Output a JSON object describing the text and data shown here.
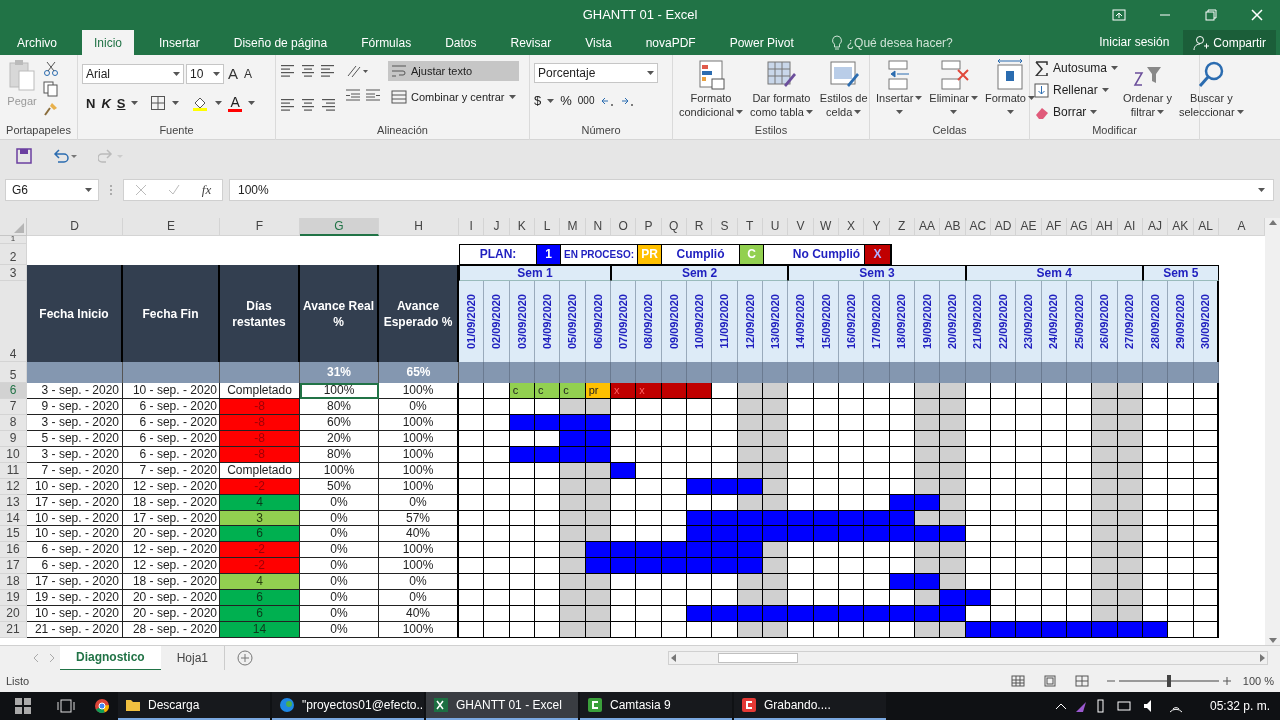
{
  "window": {
    "title": "GHANTT 01 - Excel"
  },
  "menu_tabs": [
    {
      "label": "Archivo",
      "selected": false
    },
    {
      "label": "Inicio",
      "selected": true
    },
    {
      "label": "Insertar",
      "selected": false
    },
    {
      "label": "Diseño de página",
      "selected": false
    },
    {
      "label": "Fórmulas",
      "selected": false
    },
    {
      "label": "Datos",
      "selected": false
    },
    {
      "label": "Revisar",
      "selected": false
    },
    {
      "label": "Vista",
      "selected": false
    },
    {
      "label": "novaPDF",
      "selected": false
    },
    {
      "label": "Power Pivot",
      "selected": false
    }
  ],
  "tell_me": {
    "placeholder": "¿Qué desea hacer?"
  },
  "account": {
    "sign_in": "Iniciar sesión",
    "share": "Compartir"
  },
  "ribbon": {
    "clipboard": {
      "label": "Portapapeles",
      "paste": "Pegar"
    },
    "font": {
      "label": "Fuente",
      "name": "Arial",
      "size": "10",
      "grow": "A",
      "shrink": "A",
      "bold": "N",
      "italic": "K",
      "underline": "S",
      "color_letter": "A"
    },
    "alignment": {
      "label": "Alineación",
      "wrap": "Ajustar texto",
      "wrap_on": true,
      "merge": "Combinar y centrar"
    },
    "number": {
      "label": "Número",
      "format": "Porcentaje",
      "currency": "$",
      "percent": "%",
      "thousands": "000"
    },
    "styles": {
      "label": "Estilos",
      "buttons": [
        {
          "lines": [
            "Formato",
            "condicional"
          ]
        },
        {
          "lines": [
            "Dar formato",
            "como tabla"
          ]
        },
        {
          "lines": [
            "Estilos de",
            "celda"
          ]
        }
      ]
    },
    "cells": {
      "label": "Celdas",
      "buttons": [
        {
          "lines": [
            "Insertar"
          ]
        },
        {
          "lines": [
            "Eliminar"
          ]
        },
        {
          "lines": [
            "Formato"
          ]
        }
      ]
    },
    "editing": {
      "label": "Modificar",
      "small": [
        "Autosuma",
        "Rellenar",
        "Borrar"
      ],
      "buttons": [
        {
          "lines": [
            "Ordenar y",
            "filtrar"
          ]
        },
        {
          "lines": [
            "Buscar y",
            "seleccionar"
          ]
        }
      ]
    }
  },
  "formula_bar": {
    "name_box": "G6",
    "fx": "fx",
    "value": "100%"
  },
  "sheet": {
    "columns": [
      {
        "label": "D",
        "selected": false
      },
      {
        "label": "E",
        "selected": false
      },
      {
        "label": "F",
        "selected": false
      },
      {
        "label": "G",
        "selected": true
      },
      {
        "label": "H",
        "selected": false
      },
      {
        "label": "I",
        "selected": false
      },
      {
        "label": "J",
        "selected": false
      },
      {
        "label": "K",
        "selected": false
      },
      {
        "label": "L",
        "selected": false
      },
      {
        "label": "M",
        "selected": false
      },
      {
        "label": "N",
        "selected": false
      },
      {
        "label": "O",
        "selected": false
      },
      {
        "label": "P",
        "selected": false
      },
      {
        "label": "Q",
        "selected": false
      },
      {
        "label": "R",
        "selected": false
      },
      {
        "label": "S",
        "selected": false
      },
      {
        "label": "T",
        "selected": false
      },
      {
        "label": "U",
        "selected": false
      },
      {
        "label": "V",
        "selected": false
      },
      {
        "label": "W",
        "selected": false
      },
      {
        "label": "X",
        "selected": false
      },
      {
        "label": "Y",
        "selected": false
      },
      {
        "label": "Z",
        "selected": false
      },
      {
        "label": "AA",
        "selected": false
      },
      {
        "label": "AB",
        "selected": false
      },
      {
        "label": "AC",
        "selected": false
      },
      {
        "label": "AD",
        "selected": false
      },
      {
        "label": "AE",
        "selected": false
      },
      {
        "label": "AF",
        "selected": false
      },
      {
        "label": "AG",
        "selected": false
      },
      {
        "label": "AH",
        "selected": false
      },
      {
        "label": "AI",
        "selected": false
      },
      {
        "label": "AJ",
        "selected": false
      },
      {
        "label": "AK",
        "selected": false
      },
      {
        "label": "AL",
        "selected": false
      },
      {
        "label": "A",
        "selected": false
      }
    ],
    "header_rows": [
      "1",
      "2",
      "3",
      "4",
      "5"
    ],
    "legend": [
      {
        "text": "PLAN:",
        "kind": "label"
      },
      {
        "text": "1",
        "kind": "swatch",
        "color": "#0000ff"
      },
      {
        "text": "EN PROCESO:",
        "kind": "label"
      },
      {
        "text": "PR",
        "kind": "swatch",
        "color": "#ffc000"
      },
      {
        "text": "Cumplió",
        "kind": "label"
      },
      {
        "text": "C",
        "kind": "swatch",
        "color": "#92d050"
      },
      {
        "kind": "blank"
      },
      {
        "text": "No Cumplió",
        "kind": "label"
      },
      {
        "text": "X",
        "kind": "swatch",
        "color": "#c00000"
      }
    ],
    "headers": [
      "Fecha Inicio",
      "Fecha Fin",
      "Días restantes",
      "Avance Real %",
      "Avance Esperado %"
    ],
    "totals": {
      "real": "31%",
      "expected": "65%"
    },
    "weeks": [
      {
        "label": "Sem 1",
        "days": [
          {
            "date": "01/09/2020",
            "weekend": false
          },
          {
            "date": "02/09/2020",
            "weekend": false
          },
          {
            "date": "03/09/2020",
            "weekend": false
          },
          {
            "date": "04/09/2020",
            "weekend": false
          },
          {
            "date": "05/09/2020",
            "weekend": true
          },
          {
            "date": "06/09/2020",
            "weekend": true
          }
        ]
      },
      {
        "label": "Sem 2",
        "days": [
          {
            "date": "07/09/2020",
            "weekend": false
          },
          {
            "date": "08/09/2020",
            "weekend": false
          },
          {
            "date": "09/09/2020",
            "weekend": false
          },
          {
            "date": "10/09/2020",
            "weekend": false
          },
          {
            "date": "11/09/2020",
            "weekend": false
          },
          {
            "date": "12/09/2020",
            "weekend": true
          },
          {
            "date": "13/09/2020",
            "weekend": true
          }
        ]
      },
      {
        "label": "Sem 3",
        "days": [
          {
            "date": "14/09/2020",
            "weekend": false
          },
          {
            "date": "15/09/2020",
            "weekend": false
          },
          {
            "date": "16/09/2020",
            "weekend": false
          },
          {
            "date": "17/09/2020",
            "weekend": false
          },
          {
            "date": "18/09/2020",
            "weekend": false
          },
          {
            "date": "19/09/2020",
            "weekend": true
          },
          {
            "date": "20/09/2020",
            "weekend": true
          }
        ]
      },
      {
        "label": "Sem 4",
        "days": [
          {
            "date": "21/09/2020",
            "weekend": false
          },
          {
            "date": "22/09/2020",
            "weekend": false
          },
          {
            "date": "23/09/2020",
            "weekend": false
          },
          {
            "date": "24/09/2020",
            "weekend": false
          },
          {
            "date": "25/09/2020",
            "weekend": false
          },
          {
            "date": "26/09/2020",
            "weekend": true
          },
          {
            "date": "27/09/2020",
            "weekend": true
          }
        ]
      },
      {
        "label": "Sem 5",
        "days": [
          {
            "date": "28/09/2020",
            "weekend": false
          },
          {
            "date": "29/09/2020",
            "weekend": false
          },
          {
            "date": "30/09/2020",
            "weekend": false
          }
        ]
      }
    ],
    "rows": [
      {
        "num": "6",
        "start": "3 - sep. - 2020",
        "end": "10 - sep. - 2020",
        "remaining": "Completado",
        "real": "100%",
        "expected": "100%",
        "selected": true,
        "gantt": [
          {
            "kind": "empty"
          },
          {
            "kind": "empty"
          },
          {
            "kind": "done",
            "label": "c"
          },
          {
            "kind": "done",
            "label": "c"
          },
          {
            "kind": "done",
            "label": "c"
          },
          {
            "kind": "progress",
            "label": "pr"
          },
          {
            "kind": "fail",
            "label": "x"
          },
          {
            "kind": "fail",
            "label": "x"
          },
          {
            "kind": "fail"
          },
          {
            "kind": "fail"
          },
          {
            "kind": "empty"
          },
          {
            "kind": "empty"
          },
          {
            "kind": "empty"
          },
          {
            "kind": "empty"
          },
          {
            "kind": "empty"
          },
          {
            "kind": "empty"
          },
          {
            "kind": "empty"
          },
          {
            "kind": "empty"
          },
          {
            "kind": "empty"
          },
          {
            "kind": "empty"
          },
          {
            "kind": "empty"
          },
          {
            "kind": "empty"
          },
          {
            "kind": "empty"
          },
          {
            "kind": "empty"
          },
          {
            "kind": "empty"
          },
          {
            "kind": "empty"
          },
          {
            "kind": "empty"
          },
          {
            "kind": "empty"
          },
          {
            "kind": "empty"
          },
          {
            "kind": "empty"
          }
        ]
      },
      {
        "num": "7",
        "start": "9 - sep. - 2020",
        "end": "6 - sep. - 2020",
        "remaining": "-8",
        "color": "#ff0000",
        "real": "80%",
        "expected": "0%",
        "selected": false,
        "gantt": [
          {
            "kind": "empty"
          },
          {
            "kind": "empty"
          },
          {
            "kind": "empty"
          },
          {
            "kind": "empty"
          },
          {
            "kind": "empty"
          },
          {
            "kind": "empty"
          },
          {
            "kind": "empty"
          },
          {
            "kind": "empty"
          },
          {
            "kind": "empty"
          },
          {
            "kind": "empty"
          },
          {
            "kind": "empty"
          },
          {
            "kind": "empty"
          },
          {
            "kind": "empty"
          },
          {
            "kind": "empty"
          },
          {
            "kind": "empty"
          },
          {
            "kind": "empty"
          },
          {
            "kind": "empty"
          },
          {
            "kind": "empty"
          },
          {
            "kind": "empty"
          },
          {
            "kind": "empty"
          },
          {
            "kind": "empty"
          },
          {
            "kind": "empty"
          },
          {
            "kind": "empty"
          },
          {
            "kind": "empty"
          },
          {
            "kind": "empty"
          },
          {
            "kind": "empty"
          },
          {
            "kind": "empty"
          },
          {
            "kind": "empty"
          },
          {
            "kind": "empty"
          },
          {
            "kind": "empty"
          }
        ]
      },
      {
        "num": "8",
        "start": "3 - sep. - 2020",
        "end": "6 - sep. - 2020",
        "remaining": "-8",
        "color": "#ff0000",
        "real": "60%",
        "expected": "100%",
        "selected": false,
        "gantt": [
          {
            "kind": "empty"
          },
          {
            "kind": "empty"
          },
          {
            "kind": "plan"
          },
          {
            "kind": "plan"
          },
          {
            "kind": "plan"
          },
          {
            "kind": "plan"
          },
          {
            "kind": "empty"
          },
          {
            "kind": "empty"
          },
          {
            "kind": "empty"
          },
          {
            "kind": "empty"
          },
          {
            "kind": "empty"
          },
          {
            "kind": "empty"
          },
          {
            "kind": "empty"
          },
          {
            "kind": "empty"
          },
          {
            "kind": "empty"
          },
          {
            "kind": "empty"
          },
          {
            "kind": "empty"
          },
          {
            "kind": "empty"
          },
          {
            "kind": "empty"
          },
          {
            "kind": "empty"
          },
          {
            "kind": "empty"
          },
          {
            "kind": "empty"
          },
          {
            "kind": "empty"
          },
          {
            "kind": "empty"
          },
          {
            "kind": "empty"
          },
          {
            "kind": "empty"
          },
          {
            "kind": "empty"
          },
          {
            "kind": "empty"
          },
          {
            "kind": "empty"
          },
          {
            "kind": "empty"
          }
        ]
      },
      {
        "num": "9",
        "start": "5 - sep. - 2020",
        "end": "6 - sep. - 2020",
        "remaining": "-8",
        "color": "#ff0000",
        "real": "20%",
        "expected": "100%",
        "selected": false,
        "gantt": [
          {
            "kind": "empty"
          },
          {
            "kind": "empty"
          },
          {
            "kind": "empty"
          },
          {
            "kind": "empty"
          },
          {
            "kind": "plan"
          },
          {
            "kind": "plan"
          },
          {
            "kind": "empty"
          },
          {
            "kind": "empty"
          },
          {
            "kind": "empty"
          },
          {
            "kind": "empty"
          },
          {
            "kind": "empty"
          },
          {
            "kind": "empty"
          },
          {
            "kind": "empty"
          },
          {
            "kind": "empty"
          },
          {
            "kind": "empty"
          },
          {
            "kind": "empty"
          },
          {
            "kind": "empty"
          },
          {
            "kind": "empty"
          },
          {
            "kind": "empty"
          },
          {
            "kind": "empty"
          },
          {
            "kind": "empty"
          },
          {
            "kind": "empty"
          },
          {
            "kind": "empty"
          },
          {
            "kind": "empty"
          },
          {
            "kind": "empty"
          },
          {
            "kind": "empty"
          },
          {
            "kind": "empty"
          },
          {
            "kind": "empty"
          },
          {
            "kind": "empty"
          },
          {
            "kind": "empty"
          }
        ]
      },
      {
        "num": "10",
        "start": "3 - sep. - 2020",
        "end": "6 - sep. - 2020",
        "remaining": "-8",
        "color": "#ff0000",
        "real": "80%",
        "expected": "100%",
        "selected": false,
        "gantt": [
          {
            "kind": "empty"
          },
          {
            "kind": "empty"
          },
          {
            "kind": "plan"
          },
          {
            "kind": "plan"
          },
          {
            "kind": "plan"
          },
          {
            "kind": "plan"
          },
          {
            "kind": "empty"
          },
          {
            "kind": "empty"
          },
          {
            "kind": "empty"
          },
          {
            "kind": "empty"
          },
          {
            "kind": "empty"
          },
          {
            "kind": "empty"
          },
          {
            "kind": "empty"
          },
          {
            "kind": "empty"
          },
          {
            "kind": "empty"
          },
          {
            "kind": "empty"
          },
          {
            "kind": "empty"
          },
          {
            "kind": "empty"
          },
          {
            "kind": "empty"
          },
          {
            "kind": "empty"
          },
          {
            "kind": "empty"
          },
          {
            "kind": "empty"
          },
          {
            "kind": "empty"
          },
          {
            "kind": "empty"
          },
          {
            "kind": "empty"
          },
          {
            "kind": "empty"
          },
          {
            "kind": "empty"
          },
          {
            "kind": "empty"
          },
          {
            "kind": "empty"
          },
          {
            "kind": "empty"
          }
        ]
      },
      {
        "num": "11",
        "start": "7 - sep. - 2020",
        "end": "7 - sep. - 2020",
        "remaining": "Completado",
        "real": "100%",
        "expected": "100%",
        "selected": false,
        "gantt": [
          {
            "kind": "empty"
          },
          {
            "kind": "empty"
          },
          {
            "kind": "empty"
          },
          {
            "kind": "empty"
          },
          {
            "kind": "empty"
          },
          {
            "kind": "empty"
          },
          {
            "kind": "plan"
          },
          {
            "kind": "empty"
          },
          {
            "kind": "empty"
          },
          {
            "kind": "empty"
          },
          {
            "kind": "empty"
          },
          {
            "kind": "empty"
          },
          {
            "kind": "empty"
          },
          {
            "kind": "empty"
          },
          {
            "kind": "empty"
          },
          {
            "kind": "empty"
          },
          {
            "kind": "empty"
          },
          {
            "kind": "empty"
          },
          {
            "kind": "empty"
          },
          {
            "kind": "empty"
          },
          {
            "kind": "empty"
          },
          {
            "kind": "empty"
          },
          {
            "kind": "empty"
          },
          {
            "kind": "empty"
          },
          {
            "kind": "empty"
          },
          {
            "kind": "empty"
          },
          {
            "kind": "empty"
          },
          {
            "kind": "empty"
          },
          {
            "kind": "empty"
          },
          {
            "kind": "empty"
          }
        ]
      },
      {
        "num": "12",
        "start": "10 - sep. - 2020",
        "end": "12 - sep. - 2020",
        "remaining": "-2",
        "color": "#ff0000",
        "real": "50%",
        "expected": "100%",
        "selected": false,
        "gantt": [
          {
            "kind": "empty"
          },
          {
            "kind": "empty"
          },
          {
            "kind": "empty"
          },
          {
            "kind": "empty"
          },
          {
            "kind": "empty"
          },
          {
            "kind": "empty"
          },
          {
            "kind": "empty"
          },
          {
            "kind": "empty"
          },
          {
            "kind": "empty"
          },
          {
            "kind": "plan"
          },
          {
            "kind": "plan"
          },
          {
            "kind": "plan"
          },
          {
            "kind": "empty"
          },
          {
            "kind": "empty"
          },
          {
            "kind": "empty"
          },
          {
            "kind": "empty"
          },
          {
            "kind": "empty"
          },
          {
            "kind": "empty"
          },
          {
            "kind": "empty"
          },
          {
            "kind": "empty"
          },
          {
            "kind": "empty"
          },
          {
            "kind": "empty"
          },
          {
            "kind": "empty"
          },
          {
            "kind": "empty"
          },
          {
            "kind": "empty"
          },
          {
            "kind": "empty"
          },
          {
            "kind": "empty"
          },
          {
            "kind": "empty"
          },
          {
            "kind": "empty"
          },
          {
            "kind": "empty"
          }
        ]
      },
      {
        "num": "13",
        "start": "17 - sep. - 2020",
        "end": "18 - sep. - 2020",
        "remaining": "4",
        "color": "#00b050",
        "real": "0%",
        "expected": "0%",
        "selected": false,
        "gantt": [
          {
            "kind": "empty"
          },
          {
            "kind": "empty"
          },
          {
            "kind": "empty"
          },
          {
            "kind": "empty"
          },
          {
            "kind": "empty"
          },
          {
            "kind": "empty"
          },
          {
            "kind": "empty"
          },
          {
            "kind": "empty"
          },
          {
            "kind": "empty"
          },
          {
            "kind": "empty"
          },
          {
            "kind": "empty"
          },
          {
            "kind": "empty"
          },
          {
            "kind": "empty"
          },
          {
            "kind": "empty"
          },
          {
            "kind": "empty"
          },
          {
            "kind": "empty"
          },
          {
            "kind": "empty"
          },
          {
            "kind": "plan"
          },
          {
            "kind": "plan"
          },
          {
            "kind": "empty"
          },
          {
            "kind": "empty"
          },
          {
            "kind": "empty"
          },
          {
            "kind": "empty"
          },
          {
            "kind": "empty"
          },
          {
            "kind": "empty"
          },
          {
            "kind": "empty"
          },
          {
            "kind": "empty"
          },
          {
            "kind": "empty"
          },
          {
            "kind": "empty"
          },
          {
            "kind": "empty"
          }
        ]
      },
      {
        "num": "14",
        "start": "10 - sep. - 2020",
        "end": "17 - sep. - 2020",
        "remaining": "3",
        "color": "#92d050",
        "real": "0%",
        "expected": "57%",
        "selected": false,
        "gantt": [
          {
            "kind": "empty"
          },
          {
            "kind": "empty"
          },
          {
            "kind": "empty"
          },
          {
            "kind": "empty"
          },
          {
            "kind": "empty"
          },
          {
            "kind": "empty"
          },
          {
            "kind": "empty"
          },
          {
            "kind": "empty"
          },
          {
            "kind": "empty"
          },
          {
            "kind": "plan"
          },
          {
            "kind": "plan"
          },
          {
            "kind": "plan"
          },
          {
            "kind": "plan"
          },
          {
            "kind": "plan"
          },
          {
            "kind": "plan"
          },
          {
            "kind": "plan"
          },
          {
            "kind": "plan"
          },
          {
            "kind": "plan"
          },
          {
            "kind": "empty"
          },
          {
            "kind": "empty"
          },
          {
            "kind": "empty"
          },
          {
            "kind": "empty"
          },
          {
            "kind": "empty"
          },
          {
            "kind": "empty"
          },
          {
            "kind": "empty"
          },
          {
            "kind": "empty"
          },
          {
            "kind": "empty"
          },
          {
            "kind": "empty"
          },
          {
            "kind": "empty"
          },
          {
            "kind": "empty"
          }
        ]
      },
      {
        "num": "15",
        "start": "10 - sep. - 2020",
        "end": "20 - sep. - 2020",
        "remaining": "6",
        "color": "#00b050",
        "real": "0%",
        "expected": "40%",
        "selected": false,
        "gantt": [
          {
            "kind": "empty"
          },
          {
            "kind": "empty"
          },
          {
            "kind": "empty"
          },
          {
            "kind": "empty"
          },
          {
            "kind": "empty"
          },
          {
            "kind": "empty"
          },
          {
            "kind": "empty"
          },
          {
            "kind": "empty"
          },
          {
            "kind": "empty"
          },
          {
            "kind": "plan"
          },
          {
            "kind": "plan"
          },
          {
            "kind": "plan"
          },
          {
            "kind": "plan"
          },
          {
            "kind": "plan"
          },
          {
            "kind": "plan"
          },
          {
            "kind": "plan"
          },
          {
            "kind": "plan"
          },
          {
            "kind": "plan"
          },
          {
            "kind": "plan"
          },
          {
            "kind": "plan"
          },
          {
            "kind": "empty"
          },
          {
            "kind": "empty"
          },
          {
            "kind": "empty"
          },
          {
            "kind": "empty"
          },
          {
            "kind": "empty"
          },
          {
            "kind": "empty"
          },
          {
            "kind": "empty"
          },
          {
            "kind": "empty"
          },
          {
            "kind": "empty"
          },
          {
            "kind": "empty"
          }
        ]
      },
      {
        "num": "16",
        "start": "6 - sep. - 2020",
        "end": "12 - sep. - 2020",
        "remaining": "-2",
        "color": "#ff0000",
        "real": "0%",
        "expected": "100%",
        "selected": false,
        "gantt": [
          {
            "kind": "empty"
          },
          {
            "kind": "empty"
          },
          {
            "kind": "empty"
          },
          {
            "kind": "empty"
          },
          {
            "kind": "empty"
          },
          {
            "kind": "plan"
          },
          {
            "kind": "plan"
          },
          {
            "kind": "plan"
          },
          {
            "kind": "plan"
          },
          {
            "kind": "plan"
          },
          {
            "kind": "plan"
          },
          {
            "kind": "plan"
          },
          {
            "kind": "empty"
          },
          {
            "kind": "empty"
          },
          {
            "kind": "empty"
          },
          {
            "kind": "empty"
          },
          {
            "kind": "empty"
          },
          {
            "kind": "empty"
          },
          {
            "kind": "empty"
          },
          {
            "kind": "empty"
          },
          {
            "kind": "empty"
          },
          {
            "kind": "empty"
          },
          {
            "kind": "empty"
          },
          {
            "kind": "empty"
          },
          {
            "kind": "empty"
          },
          {
            "kind": "empty"
          },
          {
            "kind": "empty"
          },
          {
            "kind": "empty"
          },
          {
            "kind": "empty"
          },
          {
            "kind": "empty"
          }
        ]
      },
      {
        "num": "17",
        "start": "6 - sep. - 2020",
        "end": "12 - sep. - 2020",
        "remaining": "-2",
        "color": "#ff0000",
        "real": "0%",
        "expected": "100%",
        "selected": false,
        "gantt": [
          {
            "kind": "empty"
          },
          {
            "kind": "empty"
          },
          {
            "kind": "empty"
          },
          {
            "kind": "empty"
          },
          {
            "kind": "empty"
          },
          {
            "kind": "plan"
          },
          {
            "kind": "plan"
          },
          {
            "kind": "plan"
          },
          {
            "kind": "plan"
          },
          {
            "kind": "plan"
          },
          {
            "kind": "plan"
          },
          {
            "kind": "plan"
          },
          {
            "kind": "empty"
          },
          {
            "kind": "empty"
          },
          {
            "kind": "empty"
          },
          {
            "kind": "empty"
          },
          {
            "kind": "empty"
          },
          {
            "kind": "empty"
          },
          {
            "kind": "empty"
          },
          {
            "kind": "empty"
          },
          {
            "kind": "empty"
          },
          {
            "kind": "empty"
          },
          {
            "kind": "empty"
          },
          {
            "kind": "empty"
          },
          {
            "kind": "empty"
          },
          {
            "kind": "empty"
          },
          {
            "kind": "empty"
          },
          {
            "kind": "empty"
          },
          {
            "kind": "empty"
          },
          {
            "kind": "empty"
          }
        ]
      },
      {
        "num": "18",
        "start": "17 - sep. - 2020",
        "end": "18 - sep. - 2020",
        "remaining": "4",
        "color": "#92d050",
        "real": "0%",
        "expected": "0%",
        "selected": false,
        "gantt": [
          {
            "kind": "empty"
          },
          {
            "kind": "empty"
          },
          {
            "kind": "empty"
          },
          {
            "kind": "empty"
          },
          {
            "kind": "empty"
          },
          {
            "kind": "empty"
          },
          {
            "kind": "empty"
          },
          {
            "kind": "empty"
          },
          {
            "kind": "empty"
          },
          {
            "kind": "empty"
          },
          {
            "kind": "empty"
          },
          {
            "kind": "empty"
          },
          {
            "kind": "empty"
          },
          {
            "kind": "empty"
          },
          {
            "kind": "empty"
          },
          {
            "kind": "empty"
          },
          {
            "kind": "empty"
          },
          {
            "kind": "plan"
          },
          {
            "kind": "plan"
          },
          {
            "kind": "empty"
          },
          {
            "kind": "empty"
          },
          {
            "kind": "empty"
          },
          {
            "kind": "empty"
          },
          {
            "kind": "empty"
          },
          {
            "kind": "empty"
          },
          {
            "kind": "empty"
          },
          {
            "kind": "empty"
          },
          {
            "kind": "empty"
          },
          {
            "kind": "empty"
          },
          {
            "kind": "empty"
          }
        ]
      },
      {
        "num": "19",
        "start": "19 - sep. - 2020",
        "end": "20 - sep. - 2020",
        "remaining": "6",
        "color": "#00b050",
        "real": "0%",
        "expected": "0%",
        "selected": false,
        "gantt": [
          {
            "kind": "empty"
          },
          {
            "kind": "empty"
          },
          {
            "kind": "empty"
          },
          {
            "kind": "empty"
          },
          {
            "kind": "empty"
          },
          {
            "kind": "empty"
          },
          {
            "kind": "empty"
          },
          {
            "kind": "empty"
          },
          {
            "kind": "empty"
          },
          {
            "kind": "empty"
          },
          {
            "kind": "empty"
          },
          {
            "kind": "empty"
          },
          {
            "kind": "empty"
          },
          {
            "kind": "empty"
          },
          {
            "kind": "empty"
          },
          {
            "kind": "empty"
          },
          {
            "kind": "empty"
          },
          {
            "kind": "empty"
          },
          {
            "kind": "empty"
          },
          {
            "kind": "plan"
          },
          {
            "kind": "plan"
          },
          {
            "kind": "empty"
          },
          {
            "kind": "empty"
          },
          {
            "kind": "empty"
          },
          {
            "kind": "empty"
          },
          {
            "kind": "empty"
          },
          {
            "kind": "empty"
          },
          {
            "kind": "empty"
          },
          {
            "kind": "empty"
          },
          {
            "kind": "empty"
          }
        ]
      },
      {
        "num": "20",
        "start": "10 - sep. - 2020",
        "end": "20 - sep. - 2020",
        "remaining": "6",
        "color": "#00b050",
        "real": "0%",
        "expected": "40%",
        "selected": false,
        "gantt": [
          {
            "kind": "empty"
          },
          {
            "kind": "empty"
          },
          {
            "kind": "empty"
          },
          {
            "kind": "empty"
          },
          {
            "kind": "empty"
          },
          {
            "kind": "empty"
          },
          {
            "kind": "empty"
          },
          {
            "kind": "empty"
          },
          {
            "kind": "empty"
          },
          {
            "kind": "plan"
          },
          {
            "kind": "plan"
          },
          {
            "kind": "plan"
          },
          {
            "kind": "plan"
          },
          {
            "kind": "plan"
          },
          {
            "kind": "plan"
          },
          {
            "kind": "plan"
          },
          {
            "kind": "plan"
          },
          {
            "kind": "plan"
          },
          {
            "kind": "plan"
          },
          {
            "kind": "plan"
          },
          {
            "kind": "empty"
          },
          {
            "kind": "empty"
          },
          {
            "kind": "empty"
          },
          {
            "kind": "empty"
          },
          {
            "kind": "empty"
          },
          {
            "kind": "empty"
          },
          {
            "kind": "empty"
          },
          {
            "kind": "empty"
          },
          {
            "kind": "empty"
          },
          {
            "kind": "empty"
          }
        ]
      },
      {
        "num": "21",
        "start": "21 - sep. - 2020",
        "end": "28 - sep. - 2020",
        "remaining": "14",
        "color": "#00b050",
        "real": "0%",
        "expected": "100%",
        "selected": false,
        "gantt": [
          {
            "kind": "empty"
          },
          {
            "kind": "empty"
          },
          {
            "kind": "empty"
          },
          {
            "kind": "empty"
          },
          {
            "kind": "empty"
          },
          {
            "kind": "empty"
          },
          {
            "kind": "empty"
          },
          {
            "kind": "empty"
          },
          {
            "kind": "empty"
          },
          {
            "kind": "empty"
          },
          {
            "kind": "empty"
          },
          {
            "kind": "empty"
          },
          {
            "kind": "empty"
          },
          {
            "kind": "empty"
          },
          {
            "kind": "empty"
          },
          {
            "kind": "empty"
          },
          {
            "kind": "empty"
          },
          {
            "kind": "empty"
          },
          {
            "kind": "empty"
          },
          {
            "kind": "empty"
          },
          {
            "kind": "plan"
          },
          {
            "kind": "plan"
          },
          {
            "kind": "plan"
          },
          {
            "kind": "plan"
          },
          {
            "kind": "plan"
          },
          {
            "kind": "plan"
          },
          {
            "kind": "plan"
          },
          {
            "kind": "plan"
          },
          {
            "kind": "empty"
          },
          {
            "kind": "empty"
          }
        ]
      }
    ]
  },
  "sheet_tabs": [
    {
      "label": "Diagnostico",
      "selected": true
    },
    {
      "label": "Hoja1",
      "selected": false
    }
  ],
  "status_bar": {
    "status": "Listo",
    "zoom": "100 %",
    "level": 0.5
  },
  "taskbar": {
    "items": [
      {
        "label": "Descarga",
        "kind": "folder",
        "selected": false
      },
      {
        "label": "\"proyectos01@efecto...",
        "kind": "edge",
        "selected": false
      },
      {
        "label": "GHANTT 01 - Excel",
        "kind": "excel",
        "selected": true
      },
      {
        "label": "Camtasia 9",
        "kind": "camtasia",
        "selected": false
      },
      {
        "label": "Grabando....",
        "kind": "record",
        "selected": false
      }
    ],
    "clock": "05:32 p. m."
  }
}
